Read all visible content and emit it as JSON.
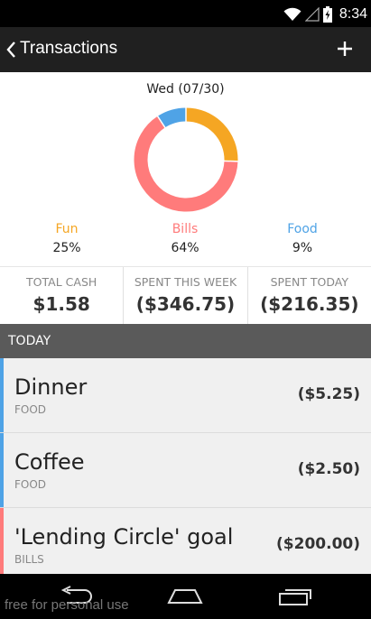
{
  "status_bar": {
    "time": "8:34"
  },
  "app_bar": {
    "title": "Transactions"
  },
  "chart": {
    "date_label": "Wed (07/30)"
  },
  "chart_data": {
    "type": "pie",
    "categories": [
      "Fun",
      "Bills",
      "Food"
    ],
    "values": [
      25,
      64,
      9
    ],
    "colors": [
      "#f5a623",
      "#ff7b7b",
      "#4fa3e6"
    ]
  },
  "legend": [
    {
      "name": "Fun",
      "percent": "25%",
      "color": "#f5a623"
    },
    {
      "name": "Bills",
      "percent": "64%",
      "color": "#ff7b7b"
    },
    {
      "name": "Food",
      "percent": "9%",
      "color": "#4fa3e6"
    }
  ],
  "stats": [
    {
      "label": "TOTAL CASH",
      "value": "$1.58"
    },
    {
      "label": "SPENT THIS WEEK",
      "value": "($346.75)"
    },
    {
      "label": "SPENT TODAY",
      "value": "($216.35)"
    }
  ],
  "section": {
    "title": "TODAY"
  },
  "transactions": [
    {
      "name": "Dinner",
      "category": "FOOD",
      "amount": "($5.25)",
      "color": "#4fa3e6"
    },
    {
      "name": "Coffee",
      "category": "FOOD",
      "amount": "($2.50)",
      "color": "#4fa3e6"
    },
    {
      "name": "'Lending Circle' goal",
      "category": "BILLS",
      "amount": "($200.00)",
      "color": "#ff7b7b"
    }
  ],
  "watermark": "free for personal use"
}
